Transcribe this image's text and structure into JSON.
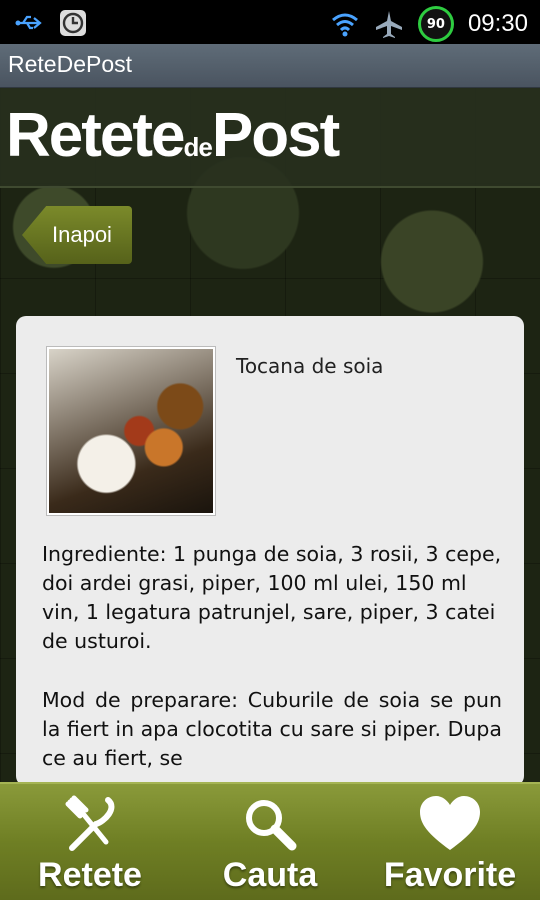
{
  "status_bar": {
    "time": "09:30",
    "battery": "90"
  },
  "app": {
    "title": "ReteDePost"
  },
  "logo": {
    "part1": "Retete",
    "part2": "de",
    "part3": "Post"
  },
  "back_button": {
    "label": "Inapoi"
  },
  "recipe": {
    "title": "Tocana de soia",
    "ingredients": "Ingrediente: 1 punga de soia, 3 rosii, 3 cepe, doi ardei grasi, piper, 100 ml ulei, 150 ml vin, 1 legatura patrunjel, sare, piper, 3 catei de usturoi.",
    "preparation": "Mod de preparare: Cuburile de soia se pun la fiert in apa clocotita cu sare si piper. Dupa ce au fiert, se"
  },
  "bottom_nav": {
    "items": [
      {
        "label": "Retete",
        "icon": "fork-knife-icon"
      },
      {
        "label": "Cauta",
        "icon": "search-icon"
      },
      {
        "label": "Favorite",
        "icon": "heart-icon"
      }
    ]
  }
}
